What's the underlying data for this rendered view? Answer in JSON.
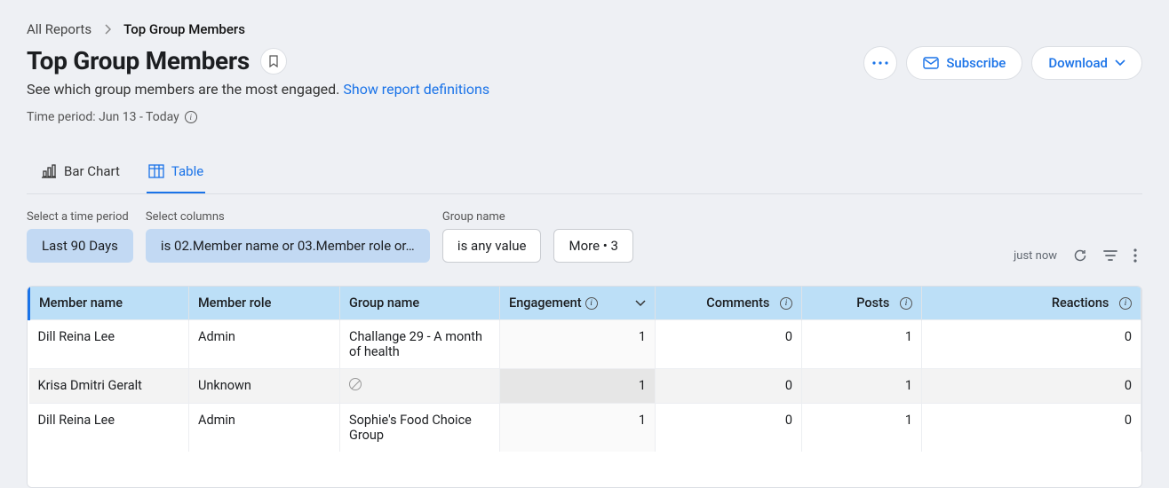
{
  "breadcrumb": {
    "root": "All Reports",
    "current": "Top Group Members"
  },
  "header": {
    "title": "Top Group Members",
    "subtitle": "See which group members are the most engaged.",
    "definitions_link": "Show report definitions",
    "time_period_label": "Time period: Jun 13 - Today"
  },
  "actions": {
    "subscribe": "Subscribe",
    "download": "Download"
  },
  "tabs": {
    "bar_chart": "Bar Chart",
    "table": "Table"
  },
  "filters": {
    "time_label": "Select a time period",
    "time_value": "Last 90 Days",
    "columns_label": "Select columns",
    "columns_value": "is 02.Member name or 03.Member role or…",
    "group_label": "Group name",
    "group_value": "is any value",
    "more_label": "More • 3"
  },
  "toolbar": {
    "refreshed": "just now"
  },
  "table": {
    "columns": {
      "member_name": "Member name",
      "member_role": "Member role",
      "group_name": "Group name",
      "engagement": "Engagement",
      "comments": "Comments",
      "posts": "Posts",
      "reactions": "Reactions"
    },
    "rows": [
      {
        "member_name": "Dill Reina Lee",
        "member_role": "Admin",
        "group_name": "Challange 29 - A month of health",
        "engagement": "1",
        "comments": "0",
        "posts": "1",
        "reactions": "0"
      },
      {
        "member_name": "Krisa Dmitri Geralt",
        "member_role": "Unknown",
        "group_name": null,
        "engagement": "1",
        "comments": "0",
        "posts": "1",
        "reactions": "0"
      },
      {
        "member_name": "Dill Reina Lee",
        "member_role": "Admin",
        "group_name": "Sophie's Food Choice Group",
        "engagement": "1",
        "comments": "0",
        "posts": "1",
        "reactions": "0"
      }
    ]
  }
}
